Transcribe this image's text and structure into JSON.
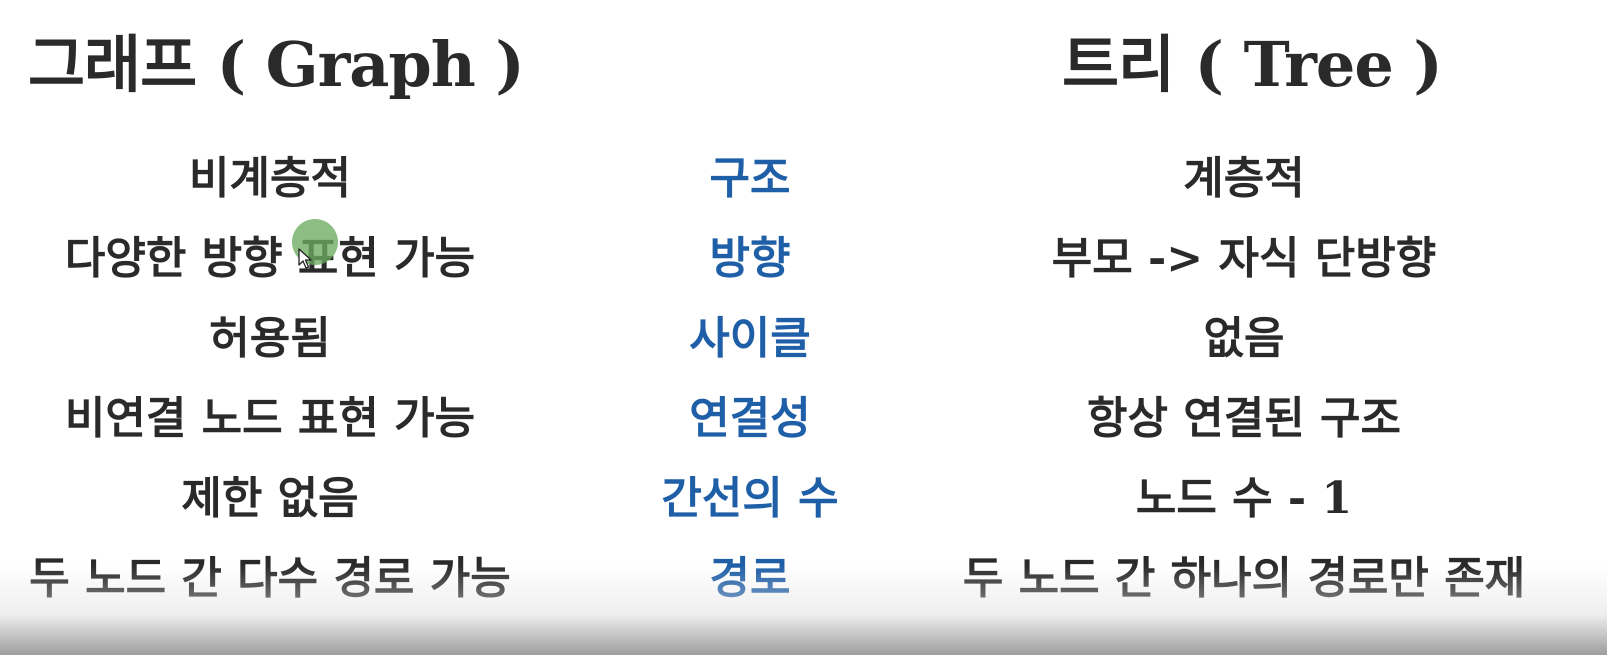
{
  "headings": {
    "graph": "그래프 ( Graph )",
    "tree": "트리 ( Tree )"
  },
  "rows": [
    {
      "graph": "비계층적",
      "criterion": "구조",
      "tree": "계층적"
    },
    {
      "graph": "다양한 방향 표현 가능",
      "criterion": "방향",
      "tree": "부모 -> 자식 단방향"
    },
    {
      "graph": "허용됨",
      "criterion": "사이클",
      "tree": "없음"
    },
    {
      "graph": "비연결 노드 표현 가능",
      "criterion": "연결성",
      "tree": "항상 연결된 구조"
    },
    {
      "graph": "제한 없음",
      "criterion": "간선의 수",
      "tree": "노드 수 - 1"
    },
    {
      "graph": "두 노드 간 다수 경로 가능",
      "criterion": "경로",
      "tree": "두 노드 간 하나의 경로만 존재"
    }
  ],
  "colors": {
    "criterion": "#1f5fa8",
    "text": "#2a2a2a",
    "background": "#ffffff",
    "cursor_highlight": "#6caa5f"
  },
  "icons": {
    "cursor": "mouse-pointer-icon"
  }
}
